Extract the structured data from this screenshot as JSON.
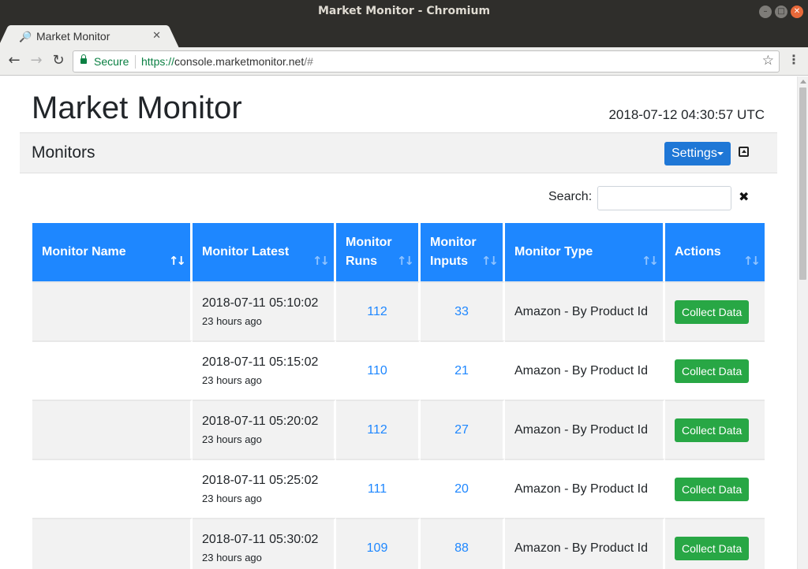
{
  "window": {
    "title": "Market Monitor - Chromium"
  },
  "tab": {
    "title": "Market Monitor"
  },
  "address_bar": {
    "secure_label": "Secure",
    "url_scheme": "https://",
    "url_host": "console.marketmonitor.net",
    "url_hash": "/#"
  },
  "page": {
    "title": "Market Monitor",
    "timestamp": "2018-07-12 04:30:57 UTC"
  },
  "card": {
    "title": "Monitors",
    "settings_label": "Settings"
  },
  "search": {
    "label": "Search:",
    "value": "",
    "placeholder": ""
  },
  "table": {
    "headers": {
      "name": "Monitor Name",
      "latest": "Monitor Latest",
      "runs_line1": "Monitor",
      "runs_line2": "Runs",
      "inputs_line1": "Monitor",
      "inputs_line2": "Inputs",
      "type": "Monitor Type",
      "actions": "Actions"
    },
    "rows": [
      {
        "name": "",
        "latest": "2018-07-11 05:10:02",
        "ago": "23 hours ago",
        "runs": "112",
        "inputs": "33",
        "type": "Amazon - By Product Id",
        "action": "Collect Data"
      },
      {
        "name": "",
        "latest": "2018-07-11 05:15:02",
        "ago": "23 hours ago",
        "runs": "110",
        "inputs": "21",
        "type": "Amazon - By Product Id",
        "action": "Collect Data"
      },
      {
        "name": "",
        "latest": "2018-07-11 05:20:02",
        "ago": "23 hours ago",
        "runs": "112",
        "inputs": "27",
        "type": "Amazon - By Product Id",
        "action": "Collect Data"
      },
      {
        "name": "",
        "latest": "2018-07-11 05:25:02",
        "ago": "23 hours ago",
        "runs": "111",
        "inputs": "20",
        "type": "Amazon - By Product Id",
        "action": "Collect Data"
      },
      {
        "name": "",
        "latest": "2018-07-11 05:30:02",
        "ago": "23 hours ago",
        "runs": "109",
        "inputs": "88",
        "type": "Amazon - By Product Id",
        "action": "Collect Data"
      }
    ]
  },
  "colors": {
    "header_blue": "#1e87ff",
    "settings_blue": "#1f77d6",
    "collect_green": "#28a745",
    "link_blue": "#1e87ff"
  }
}
